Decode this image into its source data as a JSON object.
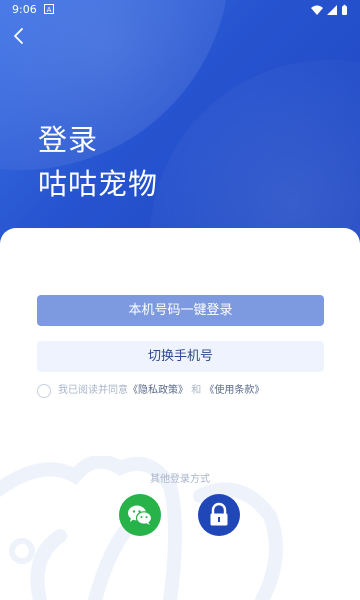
{
  "status_bar": {
    "time": "9:06",
    "notification_glyph": "A"
  },
  "hero": {
    "title_line1": "登录",
    "title_line2": "咕咕宠物"
  },
  "buttons": {
    "one_click_login": "本机号码一键登录",
    "switch_phone": "切换手机号"
  },
  "agreement": {
    "prefix": "我已阅读并同意",
    "privacy": "《隐私政策》",
    "and": "和",
    "terms": "《使用条款》"
  },
  "other_login": {
    "label": "其他登录方式",
    "options": [
      "wechat-icon",
      "lock-icon"
    ]
  },
  "colors": {
    "hero_blue": "#2653cf",
    "primary_button": "#7d99e0",
    "wechat_green": "#27b24a",
    "lock_blue": "#1f47b8"
  }
}
